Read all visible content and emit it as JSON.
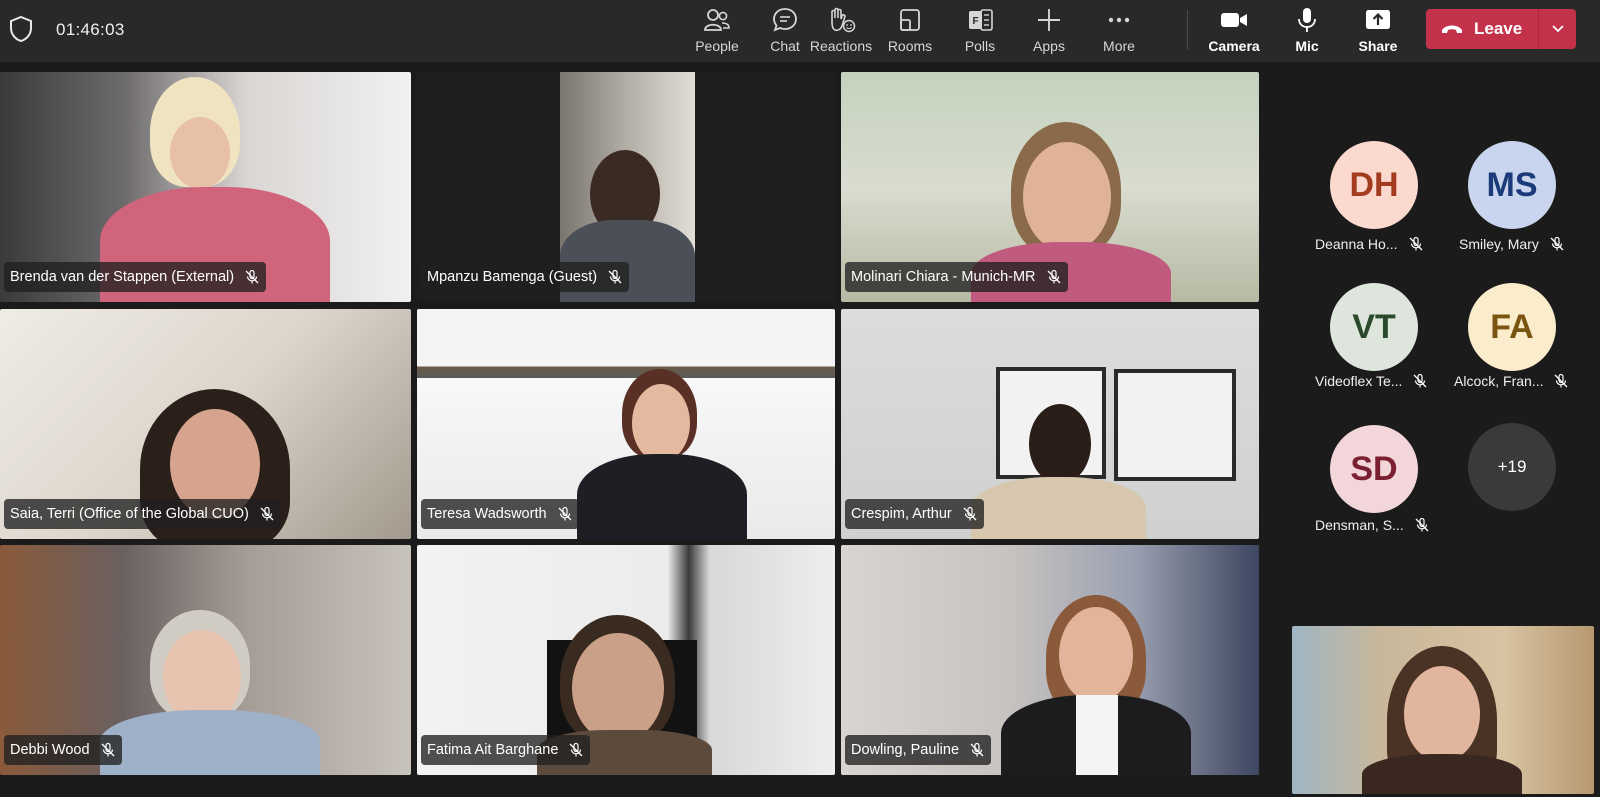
{
  "meeting": {
    "elapsed": "01:46:03"
  },
  "toolbar": {
    "people": "People",
    "chat": "Chat",
    "reactions": "Reactions",
    "rooms": "Rooms",
    "polls": "Polls",
    "apps": "Apps",
    "more": "More",
    "camera": "Camera",
    "mic": "Mic",
    "share": "Share",
    "leave": "Leave"
  },
  "tiles": [
    {
      "name": "Brenda van der Stappen (External)",
      "muted": true
    },
    {
      "name": "Mpanzu Bamenga (Guest)",
      "muted": true
    },
    {
      "name": "Molinari Chiara - Munich-MR",
      "muted": true
    },
    {
      "name": "Saia, Terri (Office of the Global CUO)",
      "muted": true
    },
    {
      "name": "Teresa Wadsworth",
      "muted": true
    },
    {
      "name": "Crespim, Arthur",
      "muted": true
    },
    {
      "name": "Debbi Wood",
      "muted": true
    },
    {
      "name": "Fatima Ait Barghane",
      "muted": true
    },
    {
      "name": "Dowling, Pauline",
      "muted": true
    }
  ],
  "roster": [
    {
      "initials": "DH",
      "name": "Deanna Ho...",
      "bg": "#fbd9cf",
      "fg": "#a33b1e"
    },
    {
      "initials": "MS",
      "name": "Smiley, Mary",
      "bg": "#c9d5ee",
      "fg": "#1a3a7a"
    },
    {
      "initials": "VT",
      "name": "Videoflex Te...",
      "bg": "#dde5dd",
      "fg": "#2b4a2b"
    },
    {
      "initials": "FA",
      "name": "Alcock, Fran...",
      "bg": "#fbeccb",
      "fg": "#7a5510"
    },
    {
      "initials": "SD",
      "name": "Densman, S...",
      "bg": "#f3d6da",
      "fg": "#7a2030"
    }
  ],
  "overflow_count": "+19",
  "colors": {
    "topbar": "#292929",
    "leave": "#c4314b",
    "stage": "#1b1b1b"
  }
}
